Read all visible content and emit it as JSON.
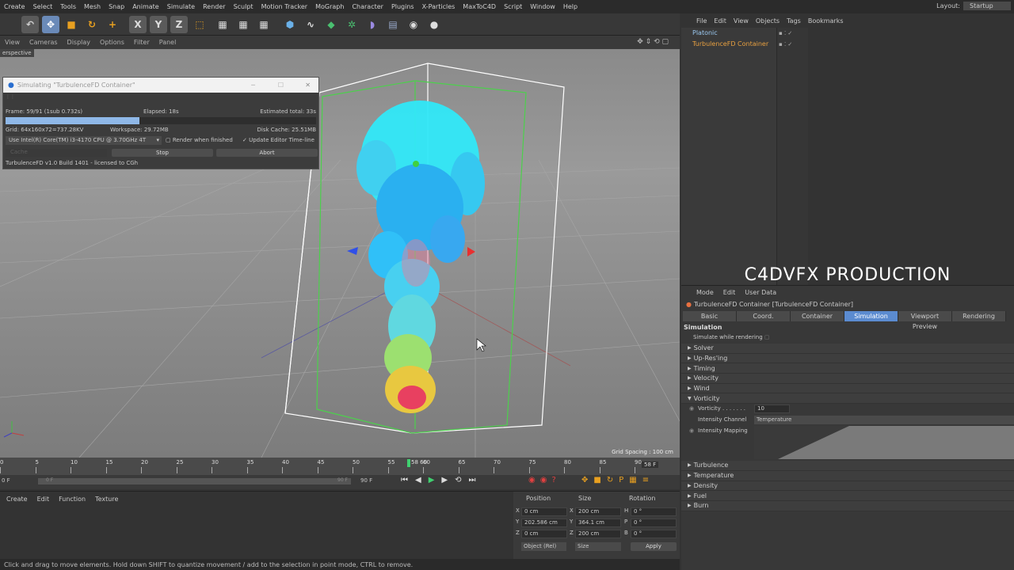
{
  "menu": [
    "Create",
    "Select",
    "Tools",
    "Mesh",
    "Snap",
    "Animate",
    "Simulate",
    "Render",
    "Sculpt",
    "Motion Tracker",
    "MoGraph",
    "Character",
    "Plugins",
    "X-Particles",
    "MaxToC4D",
    "Script",
    "Window",
    "Help"
  ],
  "layout": {
    "label": "Layout:",
    "value": "Startup"
  },
  "viewport_menu": [
    "View",
    "Cameras",
    "Display",
    "Options",
    "Filter",
    "Panel"
  ],
  "viewport_name": "erspective",
  "grid_spacing": "Grid Spacing : 100 cm",
  "dialog": {
    "title": "Simulating \"TurbulenceFD Container\"",
    "frame": "Frame: 59/91 (1sub 0.732s)",
    "elapsed": "Elapsed: 18s",
    "estimated": "Estimated total: 33s",
    "progress": 0.65,
    "grid": "Grid: 64x160x72=737.28KV",
    "workspace": "Workspace: 29.72MB",
    "disk_cache": "Disk Cache: 25.51MB",
    "device": "Use  Intel(R) Core(TM) i3-4170 CPU @ 3.70GHz 4T",
    "render_finished": "Render when finished",
    "update_editor": "Update Editor Time-line",
    "cache": "Cache",
    "stop": "Stop",
    "abort": "Abort",
    "version": "TurbulenceFD v1.0 Build 1401 - licensed to CGh"
  },
  "timeline": {
    "ticks": [
      "0",
      "5",
      "10",
      "15",
      "20",
      "25",
      "30",
      "35",
      "40",
      "45",
      "50",
      "55",
      "60",
      "65",
      "70",
      "75",
      "80",
      "85",
      "90"
    ],
    "current": "58 60",
    "frame_label": "58 F",
    "start": "0 F",
    "start2": "0 F",
    "end": "90 F",
    "end2": "90 F"
  },
  "material_menu": [
    "Create",
    "Edit",
    "Function",
    "Texture"
  ],
  "coords": {
    "headers": [
      "Position",
      "Size",
      "Rotation"
    ],
    "rows": [
      {
        "a": "X",
        "pos": "0 cm",
        "b": "X",
        "size": "200 cm",
        "c": "H",
        "rot": "0 °"
      },
      {
        "a": "Y",
        "pos": "202.586 cm",
        "b": "Y",
        "size": "364.1 cm",
        "c": "P",
        "rot": "0 °"
      },
      {
        "a": "Z",
        "pos": "0 cm",
        "b": "Z",
        "size": "200 cm",
        "c": "B",
        "rot": "0 °"
      }
    ],
    "mode": "Object (Rel)",
    "size_mode": "Size",
    "apply": "Apply"
  },
  "status": "Click and drag to move elements. Hold down SHIFT to quantize movement / add to the selection in point mode, CTRL to remove.",
  "objmgr": {
    "menu": [
      "File",
      "Edit",
      "View",
      "Objects",
      "Tags",
      "Bookmarks"
    ],
    "objects": [
      "Platonic",
      "TurbulenceFD Container"
    ]
  },
  "watermark": "C4DVFX PRODUCTION",
  "attr": {
    "menu": [
      "Mode",
      "Edit",
      "User Data"
    ],
    "object": "TurbulenceFD Container [TurbulenceFD Container]",
    "tabs": [
      "Basic",
      "Coord.",
      "Container",
      "Simulation",
      "Viewport Preview",
      "Rendering"
    ],
    "active_tab": "Simulation",
    "section": "Simulation",
    "simulate_render": "Simulate while rendering",
    "groups_top": [
      "Solver",
      "Up-Res'ing",
      "Timing",
      "Velocity",
      "Wind",
      "Vorticity"
    ],
    "vorticity_label": "Vorticity . . . . . . .",
    "vorticity_value": "10",
    "intensity_channel_label": "Intensity Channel",
    "intensity_channel": "Temperature",
    "intensity_mapping": "Intensity Mapping",
    "groups_bottom": [
      "Turbulence",
      "Temperature",
      "Density",
      "Fuel",
      "Burn"
    ]
  },
  "colors": {
    "accent": "#5b8bd0",
    "progress": "#8fb8e8",
    "obj_selected": "#e8a040"
  }
}
